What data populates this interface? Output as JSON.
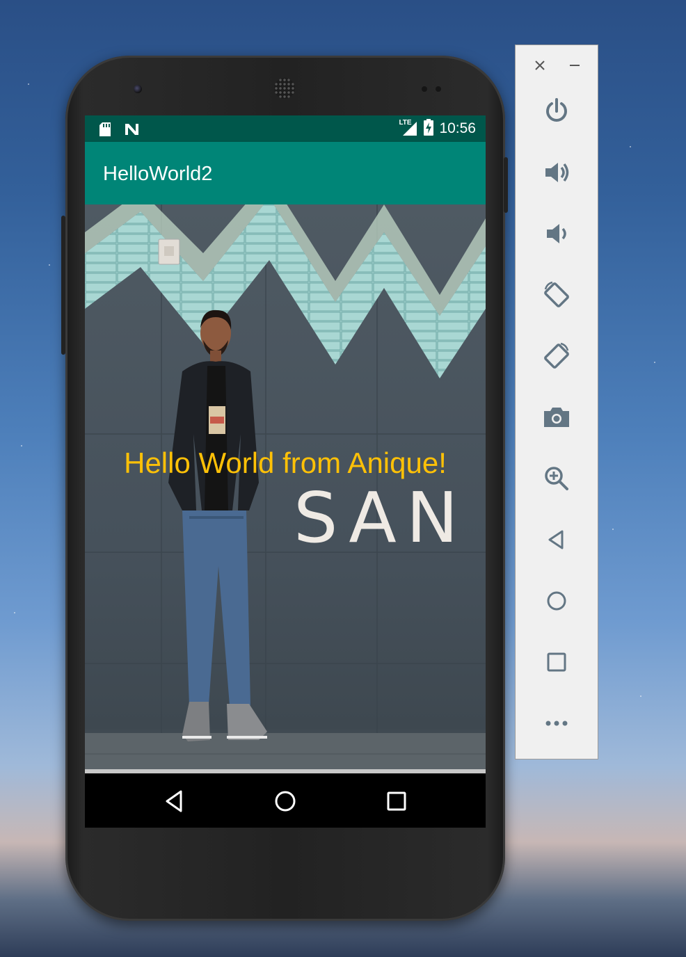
{
  "statusbar": {
    "icons": [
      "sd-card-icon",
      "n-notification-icon",
      "lte-signal-icon",
      "battery-charging-icon"
    ],
    "network_label": "LTE",
    "time": "10:56"
  },
  "app": {
    "title": "HelloWorld2",
    "accent_color": "#008577",
    "statusbar_color": "#00574b"
  },
  "content": {
    "greeting": "Hello World from Anique!",
    "greeting_color": "#ffc107",
    "wall_sign": "SAN"
  },
  "navbar": {
    "buttons": [
      "back-icon",
      "home-icon",
      "recents-icon"
    ]
  },
  "emulator_panel": {
    "window_controls": [
      "close-icon",
      "minimize-icon"
    ],
    "buttons": [
      "power-icon",
      "volume-up-icon",
      "volume-down-icon",
      "rotate-left-icon",
      "rotate-right-icon",
      "camera-icon",
      "zoom-icon",
      "back-icon",
      "home-icon",
      "overview-icon",
      "more-icon"
    ]
  }
}
